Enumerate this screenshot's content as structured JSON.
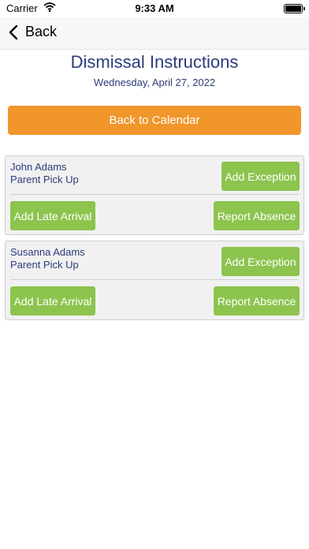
{
  "status_bar": {
    "carrier": "Carrier",
    "time": "9:33 AM"
  },
  "nav": {
    "back_label": "Back"
  },
  "header": {
    "title": "Dismissal Instructions",
    "date": "Wednesday, April 27, 2022"
  },
  "calendar_button": "Back to Calendar",
  "students": [
    {
      "name": "John Adams",
      "dismissal": "Parent Pick Up",
      "exception_label": "Add Exception",
      "late_label": "Add Late Arrival",
      "absence_label": "Report Absence"
    },
    {
      "name": "Susanna Adams",
      "dismissal": "Parent Pick Up",
      "exception_label": "Add Exception",
      "late_label": "Add Late Arrival",
      "absence_label": "Report Absence"
    }
  ],
  "colors": {
    "title": "#2c3b7a",
    "orange_button": "#f0962b",
    "green_button": "#8cc44e"
  }
}
